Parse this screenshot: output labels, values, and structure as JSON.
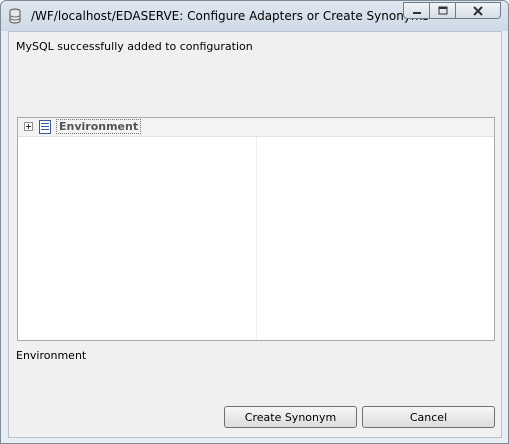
{
  "window": {
    "title": "/WF/localhost/EDASERVE: Configure Adapters or Create Synonyms",
    "icon": "database-icon"
  },
  "status_message": "MySQL successfully added to configuration",
  "tree": {
    "root_label": "Environment",
    "expander_icon": "plus-expander-icon",
    "node_icon": "document-icon"
  },
  "selection_label": "Environment",
  "buttons": {
    "create_synonym": "Create Synonym",
    "cancel": "Cancel"
  },
  "colors": {
    "window_frame": "#cfdae6",
    "client_bg": "#f0f0f0",
    "tree_bg": "#ffffff"
  }
}
